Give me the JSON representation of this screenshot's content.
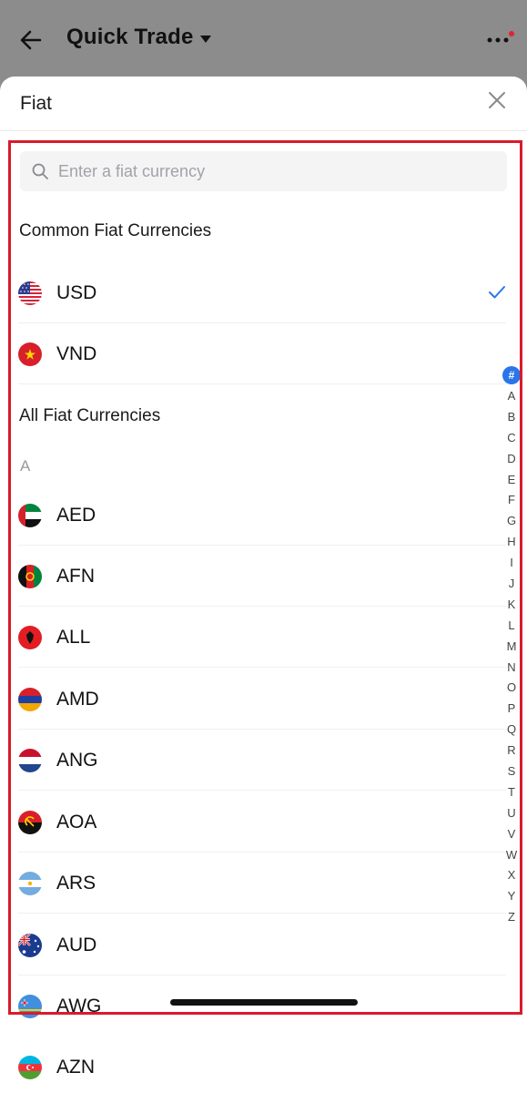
{
  "topbar": {
    "title": "Quick Trade"
  },
  "sheet": {
    "title": "Fiat",
    "search_placeholder": "Enter a fiat currency"
  },
  "common": {
    "title": "Common Fiat Currencies",
    "items": [
      {
        "code": "USD",
        "selected": true
      },
      {
        "code": "VND",
        "selected": false
      }
    ]
  },
  "all": {
    "title": "All Fiat Currencies",
    "letter": "A",
    "items": [
      {
        "code": "AED"
      },
      {
        "code": "AFN"
      },
      {
        "code": "ALL"
      },
      {
        "code": "AMD"
      },
      {
        "code": "ANG"
      },
      {
        "code": "AOA"
      },
      {
        "code": "ARS"
      },
      {
        "code": "AUD"
      },
      {
        "code": "AWG"
      },
      {
        "code": "AZN"
      }
    ]
  },
  "index": [
    "#",
    "A",
    "B",
    "C",
    "D",
    "E",
    "F",
    "G",
    "H",
    "I",
    "J",
    "K",
    "L",
    "M",
    "N",
    "O",
    "P",
    "Q",
    "R",
    "S",
    "T",
    "U",
    "V",
    "W",
    "X",
    "Y",
    "Z"
  ],
  "colors": {
    "accent": "#2a75e8",
    "highlight": "#d81b2c",
    "check": "#2a75e8"
  }
}
